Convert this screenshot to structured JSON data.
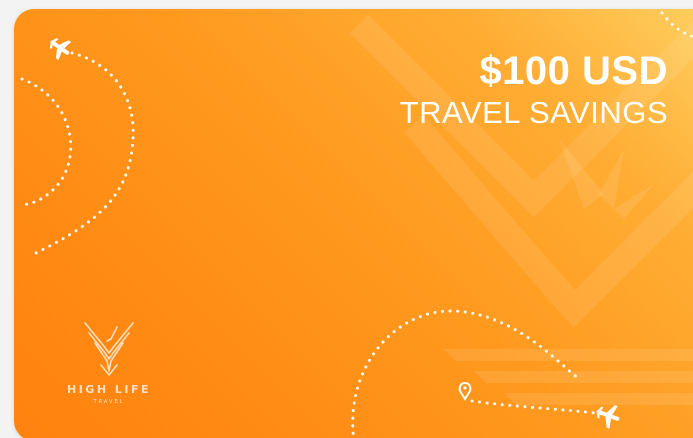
{
  "card": {
    "amount": "$100 USD",
    "subtitle": "TRAVEL SAVINGS",
    "brand_name": "HIGH LIFE",
    "brand_tagline": "TRAVEL",
    "colors": {
      "gradient_start": "#ffd061",
      "gradient_end": "#ff820f",
      "text": "#ffffff"
    },
    "icons": [
      "airplane-icon",
      "airplane-icon",
      "location-pin-icon",
      "eagle-logo-icon"
    ]
  }
}
